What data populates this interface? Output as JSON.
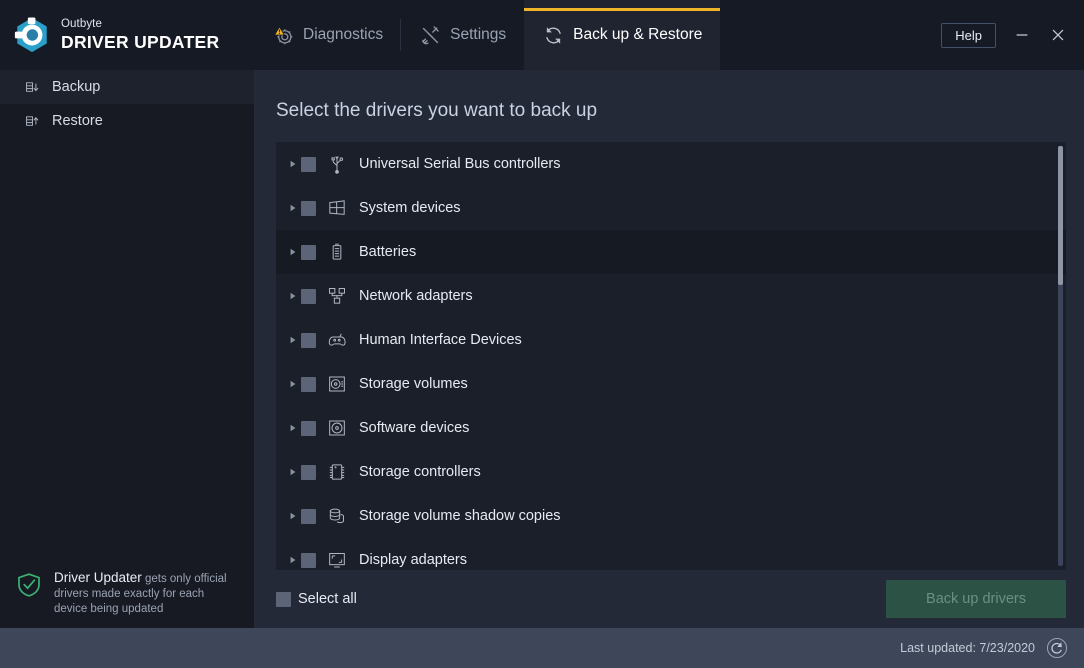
{
  "brand": {
    "top_label": "Outbyte",
    "main_label": "DRIVER UPDATER",
    "logo_icon": "outbyte-hexagon-gear-logo",
    "logo_color": "#2a9fc9"
  },
  "tabs": [
    {
      "label": "Diagnostics",
      "icon": "gear-warning-icon",
      "active": false
    },
    {
      "label": "Settings",
      "icon": "wrench-screwdriver-icon",
      "active": false
    },
    {
      "label": "Back up & Restore",
      "icon": "refresh-circular-arrows-icon",
      "active": true
    }
  ],
  "window_controls": {
    "help_label": "Help",
    "minimize_icon": "minimize-icon",
    "close_icon": "close-icon"
  },
  "sidebar": {
    "items": [
      {
        "label": "Backup",
        "icon": "backup-download-icon",
        "active": true
      },
      {
        "label": "Restore",
        "icon": "restore-upload-icon",
        "active": false
      }
    ],
    "promo": {
      "icon": "shield-check-icon",
      "icon_color": "#3bb273",
      "strong": "Driver Updater",
      "rest": " gets only official drivers made exactly for each device being updated"
    }
  },
  "main": {
    "title": "Select the drivers you want to back up",
    "rows": [
      {
        "label": "Universal Serial Bus controllers",
        "icon": "usb-icon",
        "checked": false,
        "hover": false
      },
      {
        "label": "System devices",
        "icon": "windows-logo-icon",
        "checked": false,
        "hover": false
      },
      {
        "label": "Batteries",
        "icon": "battery-icon",
        "checked": false,
        "hover": true
      },
      {
        "label": "Network adapters",
        "icon": "network-adapter-icon",
        "checked": false,
        "hover": false
      },
      {
        "label": "Human Interface Devices",
        "icon": "gamepad-icon",
        "checked": false,
        "hover": false
      },
      {
        "label": "Storage volumes",
        "icon": "storage-volume-disk-icon",
        "checked": false,
        "hover": false
      },
      {
        "label": "Software devices",
        "icon": "software-disc-icon",
        "checked": false,
        "hover": false
      },
      {
        "label": "Storage controllers",
        "icon": "chip-icon",
        "checked": false,
        "hover": false
      },
      {
        "label": "Storage volume shadow copies",
        "icon": "database-stack-icon",
        "checked": false,
        "hover": false
      },
      {
        "label": "Display adapters",
        "icon": "display-adapter-icon",
        "checked": false,
        "hover": false
      }
    ],
    "scroll": {
      "thumb_position_pct": 0,
      "thumb_size_pct": 33
    },
    "select_all_label": "Select all",
    "select_all_checked": false,
    "backup_button_label": "Back up drivers",
    "backup_button_enabled": false,
    "backup_button_color": "#2b5245"
  },
  "statusbar": {
    "last_updated_label": "Last updated: 7/23/2020",
    "refresh_icon": "refresh-circle-icon"
  }
}
